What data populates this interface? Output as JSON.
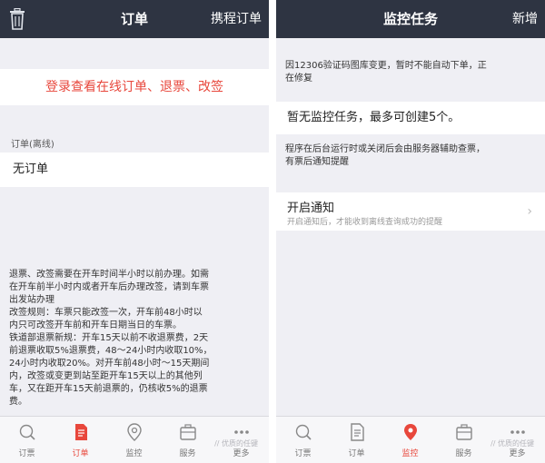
{
  "left_screen": {
    "nav": {
      "title": "订单",
      "right_label": "携程订单",
      "left_icon": "trash-icon"
    },
    "login_prompt": "登录查看在线订单、退票、改签",
    "offline_section_label": "订单(离线)",
    "empty_text": "无订单",
    "notice_lines": [
      "退票、改签需要在开车时间半小时以前办理。如需",
      "在开车前半小时内或者开车后办理改签，请到车票",
      "出发站办理",
      "改签规则：车票只能改签一次，开车前48小时以",
      "内只可改签开车前和开车日期当日的车票。",
      "铁道部退票新规：开车15天以前不收退票费，2天",
      "前退票收取5%退票费，48～24小时内收取10%，",
      "24小时内收取20%。对开车前48小时～15天期间",
      "内，改签或变更到站至距开车15天以上的其他列",
      "车，又在距开车15天前退票的，仍核收5%的退票",
      "费。"
    ],
    "watermark": "// 优质的任键",
    "active_tab": 1
  },
  "right_screen": {
    "nav": {
      "title": "监控任务",
      "right_label": "新增"
    },
    "notice_top": [
      "因12306验证码图库变更，暂时不能自动下单，正",
      "在修复"
    ],
    "monitor_empty": "暂无监控任务，最多可创建5个。",
    "notice_mid": [
      "程序在后台运行时或关闭后会由服务器辅助查票，",
      "有票后通知提醒"
    ],
    "notify": {
      "title": "开启通知",
      "subtitle": "开启通知后，才能收到离线查询成功的提醒",
      "chevron": "chevron-right-icon"
    },
    "watermark": "// 优质的任键",
    "active_tab": 2
  },
  "tabs": [
    {
      "label": "订票",
      "icon": "search-icon"
    },
    {
      "label": "订单",
      "icon": "document-icon"
    },
    {
      "label": "监控",
      "icon": "location-pin-icon"
    },
    {
      "label": "服务",
      "icon": "briefcase-icon"
    },
    {
      "label": "更多",
      "icon": "more-dots-icon"
    }
  ],
  "colors": {
    "navbar": "#2e3442",
    "accent": "#e8473c",
    "background": "#efeff4",
    "tab_inactive": "#777777"
  }
}
